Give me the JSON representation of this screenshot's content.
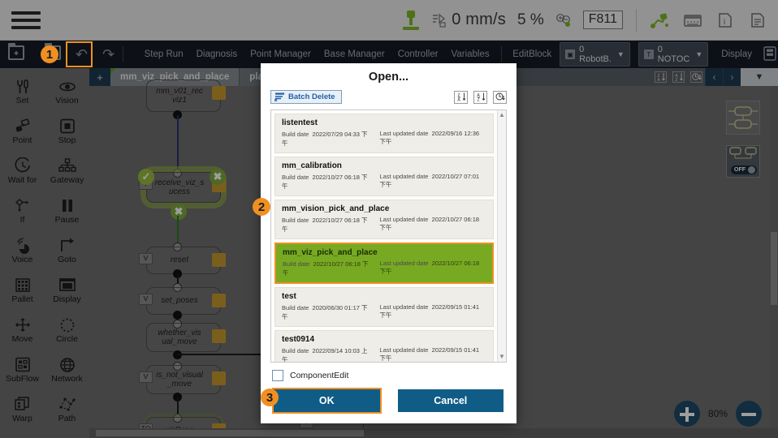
{
  "topbar": {
    "menu_icon": "hamburger-icon",
    "robot_icon": "robot-arm-icon",
    "speed_icon": "speed-icon",
    "speed_value": "0 mm/s",
    "percent_value": "5 %",
    "zoom_status_icon": "zoom-ok-icon",
    "f_code": "F811",
    "icons": [
      "robot-path-icon",
      "keyboard-icon",
      "info-icon",
      "log-icon"
    ]
  },
  "toolbar": {
    "new_file_icon": "new-file-icon",
    "open_file_icon": "open-folder-icon",
    "undo_icon": "undo-arrow-icon",
    "redo_icon": "redo-arrow-icon",
    "items": [
      "Step Run",
      "Diagnosis",
      "Point Manager",
      "Base Manager",
      "Controller",
      "Variables"
    ],
    "edit_block": "EditBlock",
    "robot_select": "0 RobotB.",
    "tool_select": "0 NOTOC",
    "display": "Display",
    "panel_icon": "panel-icon",
    "step_badge": "1"
  },
  "sidebar": {
    "items": [
      {
        "label": "Set",
        "icon": "wrench-set-icon"
      },
      {
        "label": "Vision",
        "icon": "eye-vision-icon"
      },
      {
        "label": "Point",
        "icon": "point-icon"
      },
      {
        "label": "Stop",
        "icon": "stop-square-icon"
      },
      {
        "label": "Wait for",
        "icon": "clock-wait-icon"
      },
      {
        "label": "Gateway",
        "icon": "gateway-tree-icon"
      },
      {
        "label": "If",
        "icon": "if-branch-icon"
      },
      {
        "label": "Pause",
        "icon": "pause-bars-icon"
      },
      {
        "label": "Voice",
        "icon": "voice-icon"
      },
      {
        "label": "Goto",
        "icon": "goto-arrow-icon"
      },
      {
        "label": "Pallet",
        "icon": "pallet-grid-icon"
      },
      {
        "label": "Display",
        "icon": "display-window-icon"
      },
      {
        "label": "Move",
        "icon": "move-cross-icon"
      },
      {
        "label": "Circle",
        "icon": "circle-dotted-icon"
      },
      {
        "label": "SubFlow",
        "icon": "subflow-icon"
      },
      {
        "label": "Network",
        "icon": "globe-network-icon"
      },
      {
        "label": "Warp",
        "icon": "warp-icon"
      },
      {
        "label": "Path",
        "icon": "path-points-icon"
      }
    ]
  },
  "canvas": {
    "add_tab": "+",
    "tabs": [
      {
        "label": "mm_viz_pick_and_place",
        "active": true
      },
      {
        "label": "place_se",
        "active": false
      }
    ],
    "sort_icons": [
      "sort-az-icon",
      "sort-za-icon",
      "sort-time-icon"
    ],
    "nav_prev": "‹",
    "nav_next": "›",
    "dropdown_caret": "▼",
    "nodes": [
      {
        "label": "mm_v01_rec\nviz1",
        "tag": "",
        "tool": "gateway"
      },
      {
        "label": "receive_viz_s\nucess",
        "tag": "V",
        "tool": "gateway"
      },
      {
        "label": "reset",
        "tag": "V",
        "tool": "set"
      },
      {
        "label": "set_poses",
        "tag": "V",
        "tool": "set"
      },
      {
        "label": "whether_vis\nual_move",
        "tag": "",
        "tool": "gateway"
      },
      {
        "label": "is_not_visual\n_move",
        "tag": "V",
        "tool": "gateway"
      },
      {
        "label": "vizPose",
        "tag": "TO",
        "tool": "point"
      }
    ],
    "step_badge": "2",
    "zoom_level": "80%",
    "zoom_in_icon": "zoom-in-icon",
    "zoom_out_icon": "zoom-out-icon",
    "mini_panel_icons": [
      "layout-panel-icon",
      "link-toggle-icon"
    ],
    "toggle_label": "OFF"
  },
  "modal": {
    "title": "Open...",
    "batch_delete": "Batch Delete",
    "batch_delete_icon": "batch-delete-icon",
    "sort_icons": [
      "sort-az-icon",
      "sort-za-icon",
      "sort-time-icon"
    ],
    "build_date_label": "Build date",
    "last_updated_label": "Last updated date",
    "files": [
      {
        "name": "listentest",
        "build": "2022/07/29 04:33 下午",
        "updated": "2022/09/16 12:36 下午",
        "selected": false
      },
      {
        "name": "mm_calibration",
        "build": "2022/10/27 06:18 下午",
        "updated": "2022/10/27 07:01 下午",
        "selected": false
      },
      {
        "name": "mm_vision_pick_and_place",
        "build": "2022/10/27 06:18 下午",
        "updated": "2022/10/27 06:18 下午",
        "selected": false
      },
      {
        "name": "mm_viz_pick_and_place",
        "build": "2022/10/27 06:18 下午",
        "updated": "2022/10/27 06:18 下午",
        "selected": true
      },
      {
        "name": "test",
        "build": "2020/06/30 01:17 下午",
        "updated": "2022/09/15 01:41 下午",
        "selected": false
      },
      {
        "name": "test0914",
        "build": "2022/09/14 10:03 上午",
        "updated": "2022/09/15 01:41 下午",
        "selected": false
      }
    ],
    "checkbox_label": "ComponentEdit",
    "checkbox_checked": false,
    "ok_label": "OK",
    "cancel_label": "Cancel",
    "step_badge_select": "2",
    "step_badge_ok": "3"
  },
  "colors": {
    "accent_orange": "#f09022",
    "selection_green": "#77aa22",
    "button_blue": "#0f5c87",
    "toolbar_dark": "#151c26",
    "canvas_gray": "#6e6e6e",
    "status_green": "#7cb928"
  }
}
